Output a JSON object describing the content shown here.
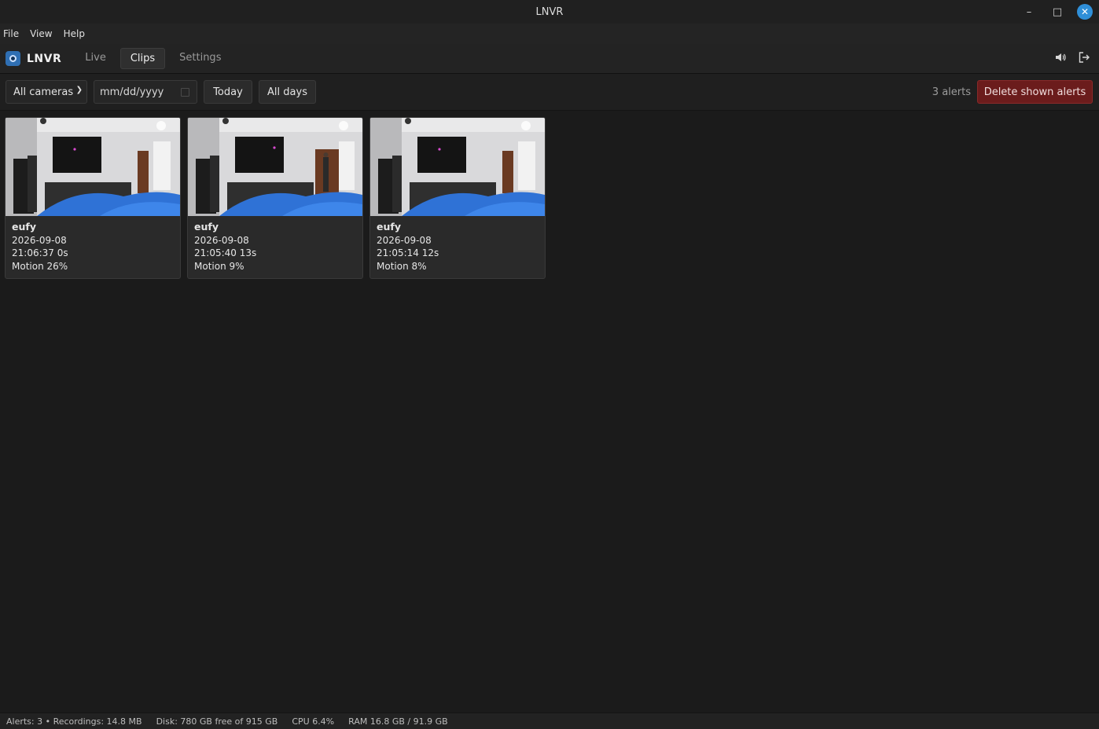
{
  "window": {
    "title": "LNVR"
  },
  "menu": {
    "items": [
      "File",
      "View",
      "Help"
    ]
  },
  "appbar": {
    "logo_text": "LNVR",
    "tabs": [
      "Live",
      "Clips",
      "Settings"
    ],
    "active_tab": "Clips",
    "icons": [
      "speaker-icon",
      "logout-icon"
    ]
  },
  "toolbar": {
    "camera_filter": "All cameras",
    "date_placeholder": "mm/dd/yyyy",
    "today_label": "Today",
    "alldays_label": "All days",
    "alerts_count": "3 alerts",
    "delete_label": "Delete shown alerts"
  },
  "clips": [
    {
      "camera": "eufy",
      "date": "2026-09-08",
      "time_duration": "21:06:37 0s",
      "motion": "Motion 26%"
    },
    {
      "camera": "eufy",
      "date": "2026-09-08",
      "time_duration": "21:05:40 13s",
      "motion": "Motion 9%"
    },
    {
      "camera": "eufy",
      "date": "2026-09-08",
      "time_duration": "21:05:14 12s",
      "motion": "Motion 8%"
    }
  ],
  "status": {
    "alerts_recordings": "Alerts: 3 • Recordings: 14.8 MB",
    "disk": "Disk: 780 GB free of 915 GB",
    "cpu": "CPU 6.4%",
    "ram": "RAM 16.8 GB / 91.9 GB"
  },
  "colors": {
    "accent": "#2f6fb3",
    "danger": "#6b1c1c",
    "close_button": "#2f8fd8"
  }
}
